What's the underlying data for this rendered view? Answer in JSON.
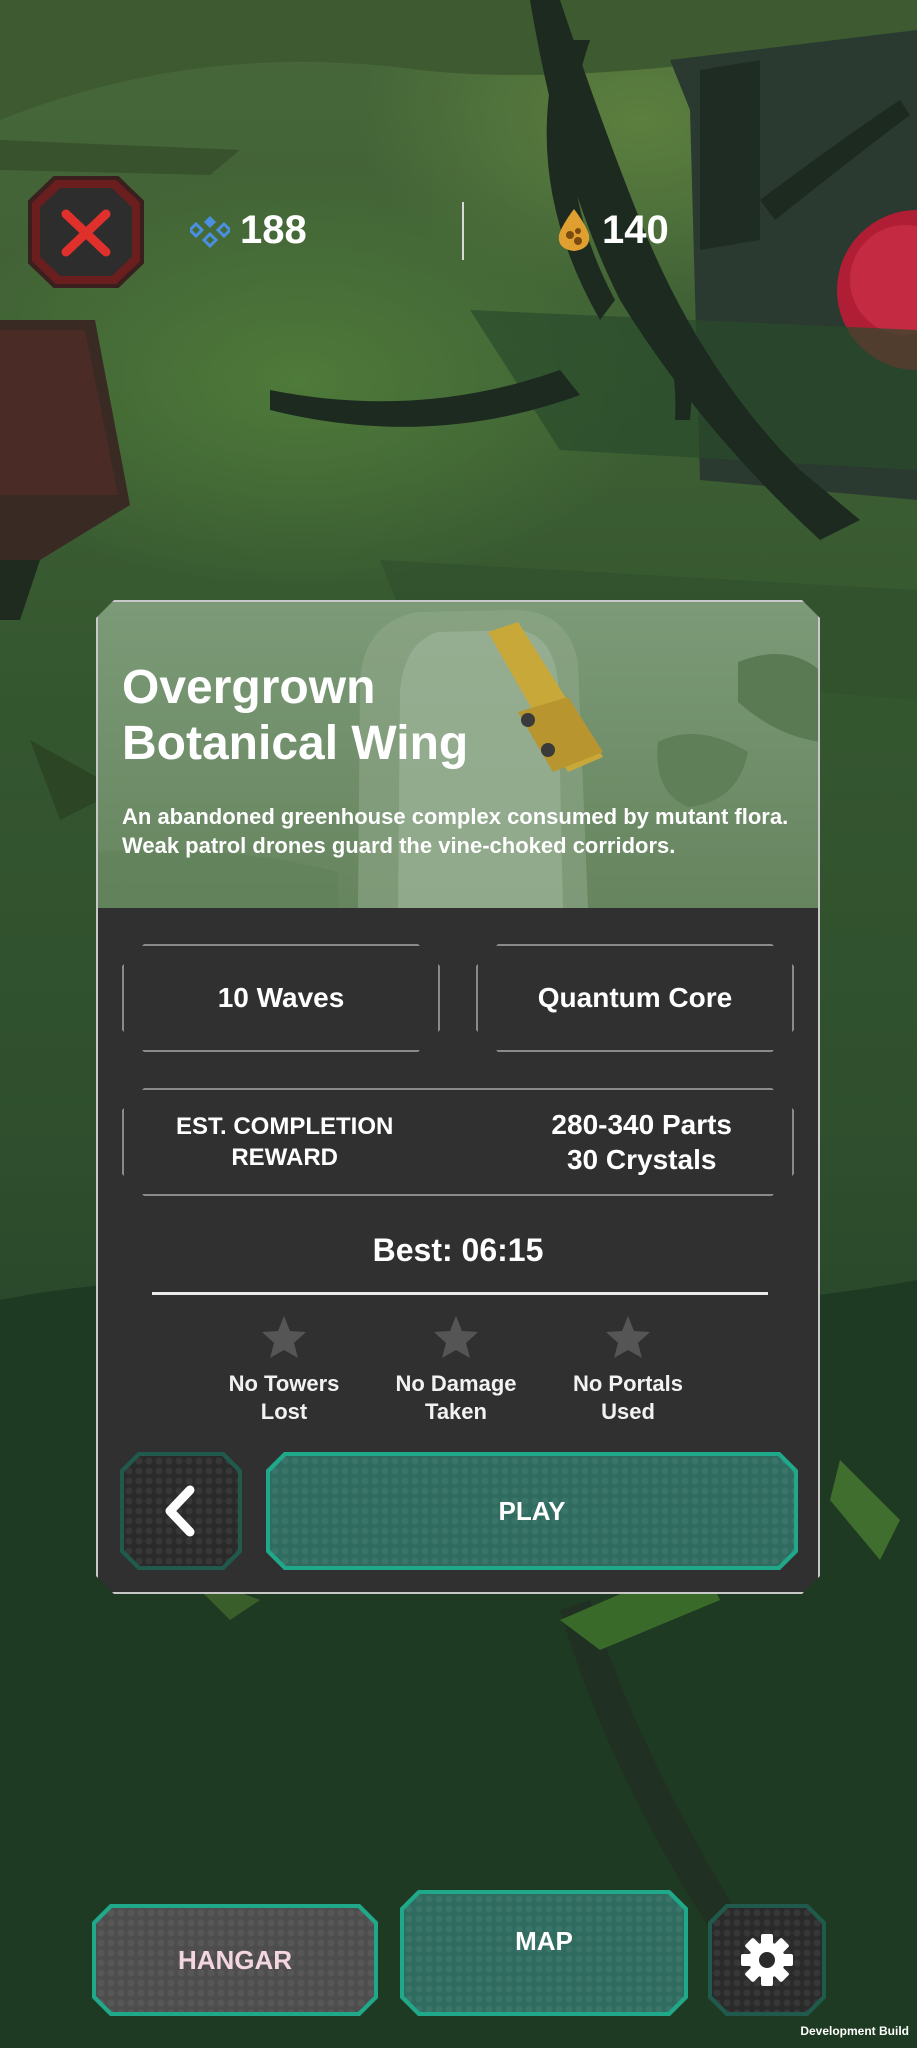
{
  "currency": {
    "crystals": "188",
    "parts": "140"
  },
  "level": {
    "title_line1": "Overgrown",
    "title_line2": "Botanical Wing",
    "description": "An abandoned greenhouse complex consumed by mutant flora. Weak patrol drones guard the vine-choked corridors.",
    "waves": "10 Waves",
    "objective": "Quantum Core",
    "reward_label_line1": "EST. COMPLETION",
    "reward_label_line2": "REWARD",
    "reward_parts": "280-340 Parts",
    "reward_crystals": "30 Crystals",
    "best_time": "Best: 06:15",
    "goals": [
      {
        "line1": "No Towers",
        "line2": "Lost",
        "achieved": false
      },
      {
        "line1": "No Damage",
        "line2": "Taken",
        "achieved": false
      },
      {
        "line1": "No Portals",
        "line2": "Used",
        "achieved": false
      }
    ],
    "play_label": "PLAY"
  },
  "nav": {
    "hangar_label": "HANGAR",
    "map_label": "MAP"
  },
  "footer": {
    "build_label": "Development Build"
  },
  "icons": {
    "close": "close-icon",
    "crystal": "crystal-icon",
    "parts": "parts-drop-icon",
    "back": "chevron-left-icon",
    "settings": "gear-icon",
    "star": "star-icon"
  },
  "colors": {
    "teal_button": "#2f6b5f",
    "teal_border": "#1fa889",
    "grey_button": "#4a4a4a",
    "close_red": "#e0302c",
    "crystal_blue": "#4a8fe0",
    "parts_gold": "#e0a030"
  }
}
